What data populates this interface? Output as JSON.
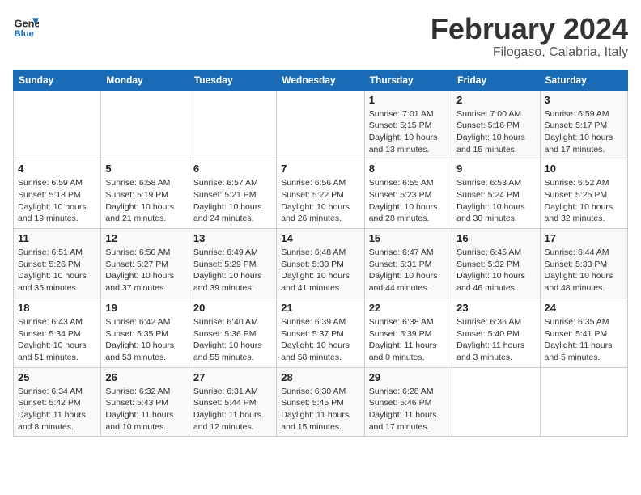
{
  "logo": {
    "line1": "General",
    "line2": "Blue"
  },
  "title": "February 2024",
  "subtitle": "Filogaso, Calabria, Italy",
  "headers": [
    "Sunday",
    "Monday",
    "Tuesday",
    "Wednesday",
    "Thursday",
    "Friday",
    "Saturday"
  ],
  "weeks": [
    [
      {
        "day": "",
        "info": ""
      },
      {
        "day": "",
        "info": ""
      },
      {
        "day": "",
        "info": ""
      },
      {
        "day": "",
        "info": ""
      },
      {
        "day": "1",
        "info": "Sunrise: 7:01 AM\nSunset: 5:15 PM\nDaylight: 10 hours\nand 13 minutes."
      },
      {
        "day": "2",
        "info": "Sunrise: 7:00 AM\nSunset: 5:16 PM\nDaylight: 10 hours\nand 15 minutes."
      },
      {
        "day": "3",
        "info": "Sunrise: 6:59 AM\nSunset: 5:17 PM\nDaylight: 10 hours\nand 17 minutes."
      }
    ],
    [
      {
        "day": "4",
        "info": "Sunrise: 6:59 AM\nSunset: 5:18 PM\nDaylight: 10 hours\nand 19 minutes."
      },
      {
        "day": "5",
        "info": "Sunrise: 6:58 AM\nSunset: 5:19 PM\nDaylight: 10 hours\nand 21 minutes."
      },
      {
        "day": "6",
        "info": "Sunrise: 6:57 AM\nSunset: 5:21 PM\nDaylight: 10 hours\nand 24 minutes."
      },
      {
        "day": "7",
        "info": "Sunrise: 6:56 AM\nSunset: 5:22 PM\nDaylight: 10 hours\nand 26 minutes."
      },
      {
        "day": "8",
        "info": "Sunrise: 6:55 AM\nSunset: 5:23 PM\nDaylight: 10 hours\nand 28 minutes."
      },
      {
        "day": "9",
        "info": "Sunrise: 6:53 AM\nSunset: 5:24 PM\nDaylight: 10 hours\nand 30 minutes."
      },
      {
        "day": "10",
        "info": "Sunrise: 6:52 AM\nSunset: 5:25 PM\nDaylight: 10 hours\nand 32 minutes."
      }
    ],
    [
      {
        "day": "11",
        "info": "Sunrise: 6:51 AM\nSunset: 5:26 PM\nDaylight: 10 hours\nand 35 minutes."
      },
      {
        "day": "12",
        "info": "Sunrise: 6:50 AM\nSunset: 5:27 PM\nDaylight: 10 hours\nand 37 minutes."
      },
      {
        "day": "13",
        "info": "Sunrise: 6:49 AM\nSunset: 5:29 PM\nDaylight: 10 hours\nand 39 minutes."
      },
      {
        "day": "14",
        "info": "Sunrise: 6:48 AM\nSunset: 5:30 PM\nDaylight: 10 hours\nand 41 minutes."
      },
      {
        "day": "15",
        "info": "Sunrise: 6:47 AM\nSunset: 5:31 PM\nDaylight: 10 hours\nand 44 minutes."
      },
      {
        "day": "16",
        "info": "Sunrise: 6:45 AM\nSunset: 5:32 PM\nDaylight: 10 hours\nand 46 minutes."
      },
      {
        "day": "17",
        "info": "Sunrise: 6:44 AM\nSunset: 5:33 PM\nDaylight: 10 hours\nand 48 minutes."
      }
    ],
    [
      {
        "day": "18",
        "info": "Sunrise: 6:43 AM\nSunset: 5:34 PM\nDaylight: 10 hours\nand 51 minutes."
      },
      {
        "day": "19",
        "info": "Sunrise: 6:42 AM\nSunset: 5:35 PM\nDaylight: 10 hours\nand 53 minutes."
      },
      {
        "day": "20",
        "info": "Sunrise: 6:40 AM\nSunset: 5:36 PM\nDaylight: 10 hours\nand 55 minutes."
      },
      {
        "day": "21",
        "info": "Sunrise: 6:39 AM\nSunset: 5:37 PM\nDaylight: 10 hours\nand 58 minutes."
      },
      {
        "day": "22",
        "info": "Sunrise: 6:38 AM\nSunset: 5:39 PM\nDaylight: 11 hours\nand 0 minutes."
      },
      {
        "day": "23",
        "info": "Sunrise: 6:36 AM\nSunset: 5:40 PM\nDaylight: 11 hours\nand 3 minutes."
      },
      {
        "day": "24",
        "info": "Sunrise: 6:35 AM\nSunset: 5:41 PM\nDaylight: 11 hours\nand 5 minutes."
      }
    ],
    [
      {
        "day": "25",
        "info": "Sunrise: 6:34 AM\nSunset: 5:42 PM\nDaylight: 11 hours\nand 8 minutes."
      },
      {
        "day": "26",
        "info": "Sunrise: 6:32 AM\nSunset: 5:43 PM\nDaylight: 11 hours\nand 10 minutes."
      },
      {
        "day": "27",
        "info": "Sunrise: 6:31 AM\nSunset: 5:44 PM\nDaylight: 11 hours\nand 12 minutes."
      },
      {
        "day": "28",
        "info": "Sunrise: 6:30 AM\nSunset: 5:45 PM\nDaylight: 11 hours\nand 15 minutes."
      },
      {
        "day": "29",
        "info": "Sunrise: 6:28 AM\nSunset: 5:46 PM\nDaylight: 11 hours\nand 17 minutes."
      },
      {
        "day": "",
        "info": ""
      },
      {
        "day": "",
        "info": ""
      }
    ]
  ]
}
